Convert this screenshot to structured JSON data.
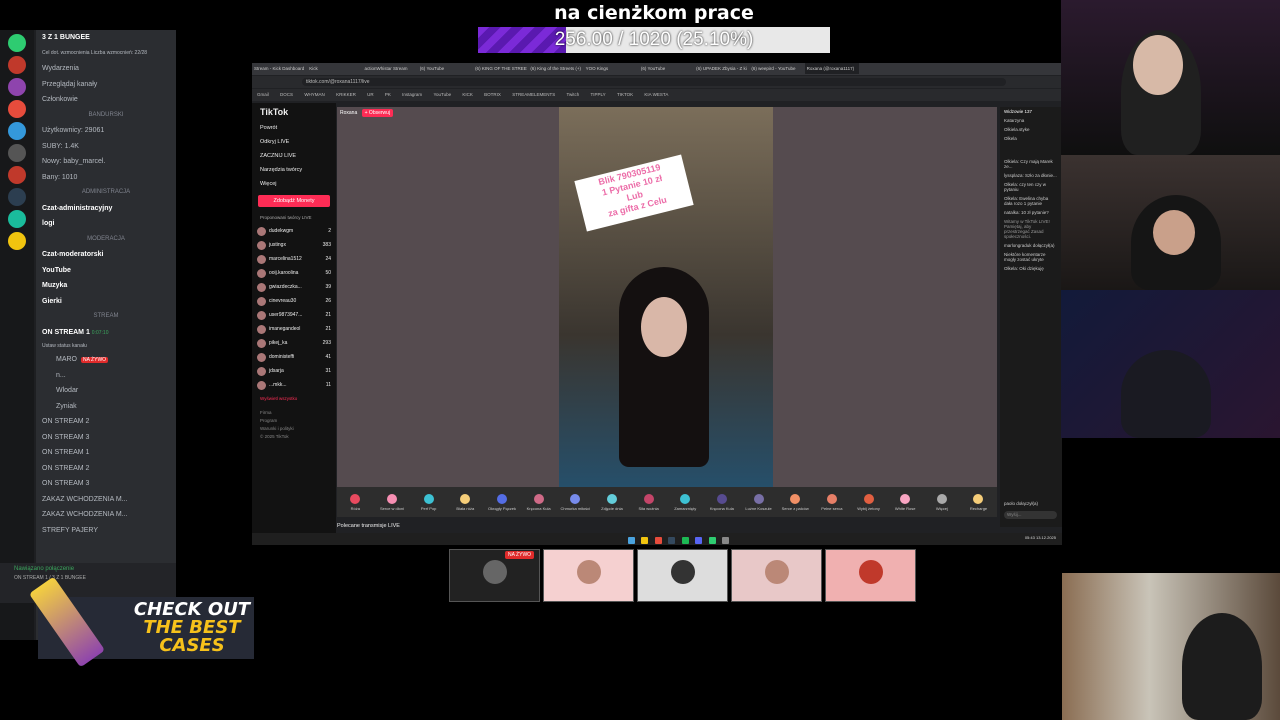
{
  "goal": {
    "title": "na cienżkom prace",
    "progress_text": "256.00 / 1020 (25.10%)",
    "fraction": 0.251
  },
  "discord": {
    "server_name": "3 Z 1 BUNGEE",
    "boost_text": "Cel dot. wzmocnienia  Liczba wzmocnień: 22/28",
    "items": [
      "Wydarzenia",
      "Przeglądaj kanały",
      "Członkowie"
    ],
    "cat1": "BANDURSKI",
    "stats": [
      "Użytkownicy: 29061",
      "SUBY: 1.4K",
      "Nowy: baby_marcel.",
      "Bany: 1010"
    ],
    "cat2": "ADMINISTRACJA",
    "admin_channels": [
      "Czat-administracyjny",
      "logi"
    ],
    "cat3": "MODERACJA",
    "mod_channels": [
      "Czat-moderatorski",
      "YouTube",
      "Muzyka",
      "Gierki"
    ],
    "cat4": "STREAM",
    "stream_active": "ON STREAM 1",
    "stream_time": "0:07:10",
    "stream_status": "Ustaw status kanału",
    "members": [
      "MARO",
      "n...",
      "Wlodar",
      "Zyniak"
    ],
    "live_label": "NA ŻYWO",
    "other_streams": [
      "ON STREAM 2",
      "ON STREAM 3",
      "ON STREAM 1",
      "ON STREAM 2",
      "ON STREAM 3",
      "ZAKAZ WCHODZENIA M...",
      "ZAKAZ WCHODZENIA M...",
      "STREFY PAJERY"
    ],
    "voice_status": "Nawiązano połączenie",
    "voice_channel": "ON STREAM 1 / 3 Z 1 BUNGEE"
  },
  "browser": {
    "tabs": [
      "Stream - Kick Dashboard",
      "Kick",
      "actionWhistar Stream",
      "(6) YouTube",
      "(6) KING OF THE STREETS",
      "(6) King of the Streets (+)",
      "YOO Kings",
      "(6) YouTube",
      "(6) UPADEK Zbysia - Z ki",
      "(6) weepird - YouTube",
      "Roxana (@roxana1117)"
    ],
    "url": "tiktok.com/@roxana1117/live",
    "bookmarks": [
      "Gmail",
      "DOCS",
      "WHYMAN",
      "KRIKKER",
      "UR",
      "PK",
      "Instagram",
      "YouTube",
      "KICK",
      "BOTRIX",
      "STREAMELEMENTS",
      "Twitch",
      "TIPPLY",
      "TIKTOK",
      "KIA WESTA"
    ]
  },
  "tiktok": {
    "logo": "TikTok",
    "nav": [
      "Powrót",
      "Odkryj LIVE",
      "ZACZNIJ LIVE",
      "Narzędzia twórcy",
      "Więcej"
    ],
    "coins_button": "Zdobądź Monety",
    "suggested_header": "Proponowani twórcy LIVE",
    "creators": [
      {
        "name": "dudekwgm",
        "count": "2"
      },
      {
        "name": "justingx",
        "count": "383"
      },
      {
        "name": "marcelina1512",
        "count": "24"
      },
      {
        "name": "ooij.karoolina",
        "count": "50"
      },
      {
        "name": "gwiazdeczka...",
        "count": "39"
      },
      {
        "name": "cinevreau30",
        "count": "26"
      },
      {
        "name": "user9873947...",
        "count": "21"
      },
      {
        "name": "imanegandeol",
        "count": "21"
      },
      {
        "name": "pikej_ka",
        "count": "293"
      },
      {
        "name": "doministeffi",
        "count": "41"
      },
      {
        "name": "jdsarja",
        "count": "31"
      },
      {
        "name": "...mkk...",
        "count": "11"
      }
    ],
    "show_all": "Wyświetl wszystko",
    "footer": [
      "Firma",
      "Program",
      "Warunki i polityki",
      "© 2025 TikTok"
    ],
    "streamer": "Roxana",
    "follow": "+ Obserwuj",
    "sign_text": [
      "Blik 790305119",
      "1 Pytanie 10 zł",
      "Lub",
      "za gifta z Celu"
    ],
    "gifts": [
      "Róża",
      "Serce w dłoni",
      "Perf Pop",
      "Biała róża",
      "Okrągły Pączek",
      "Kręcona Kula",
      "Chmurka miłości",
      "Zdjęcie dnia",
      "Siła woźnia",
      "Zamarznięty",
      "Kręcona Kula",
      "Luźne Koszule",
      "Serce z palców",
      "Pełne serca",
      "Wybij żetony",
      "White Rose",
      "Więcej",
      "Recharge"
    ],
    "recommended": "Polecane transmisje LIVE"
  },
  "chat": {
    "viewers_label": "Widzowie",
    "viewers_count": "137",
    "top_viewers": [
      "Katarzyna",
      "Olkiela.styke",
      "Olkela"
    ],
    "messages": [
      "Olkiela: Czy mają Marek ze...",
      "lyssplaza: Szło za dłonie...",
      "Olkela: czy ten czy w pytaniu",
      "Olkela: Ewelina chyba dała rozo 1 pytanie",
      "natalka: 10 zł pytanie?"
    ],
    "welcome": "Witamy w TikTok LIVE! Pamiętaj, aby przestrzegać Zasad społeczności.",
    "system": [
      "marlongraduk dołączył(a)",
      "Niektóre komentarze mogły zostać ukryte",
      "Olkela: Oki dziękuję"
    ],
    "joined": "paolo dołączył(a)",
    "input_placeholder": "Wyśij..."
  },
  "taskbar": {
    "time": "05:43",
    "date": "13.12.2025"
  },
  "thumbs": {
    "live_label": "NA ŻYWO"
  },
  "promo": {
    "line1": "CHECK OUT",
    "line2": "THE BEST",
    "line3": "CASES"
  },
  "colors": {
    "goal_fill": "#7b2ad8",
    "tiktok_red": "#fe2c55",
    "live_red": "#e02b2b"
  }
}
